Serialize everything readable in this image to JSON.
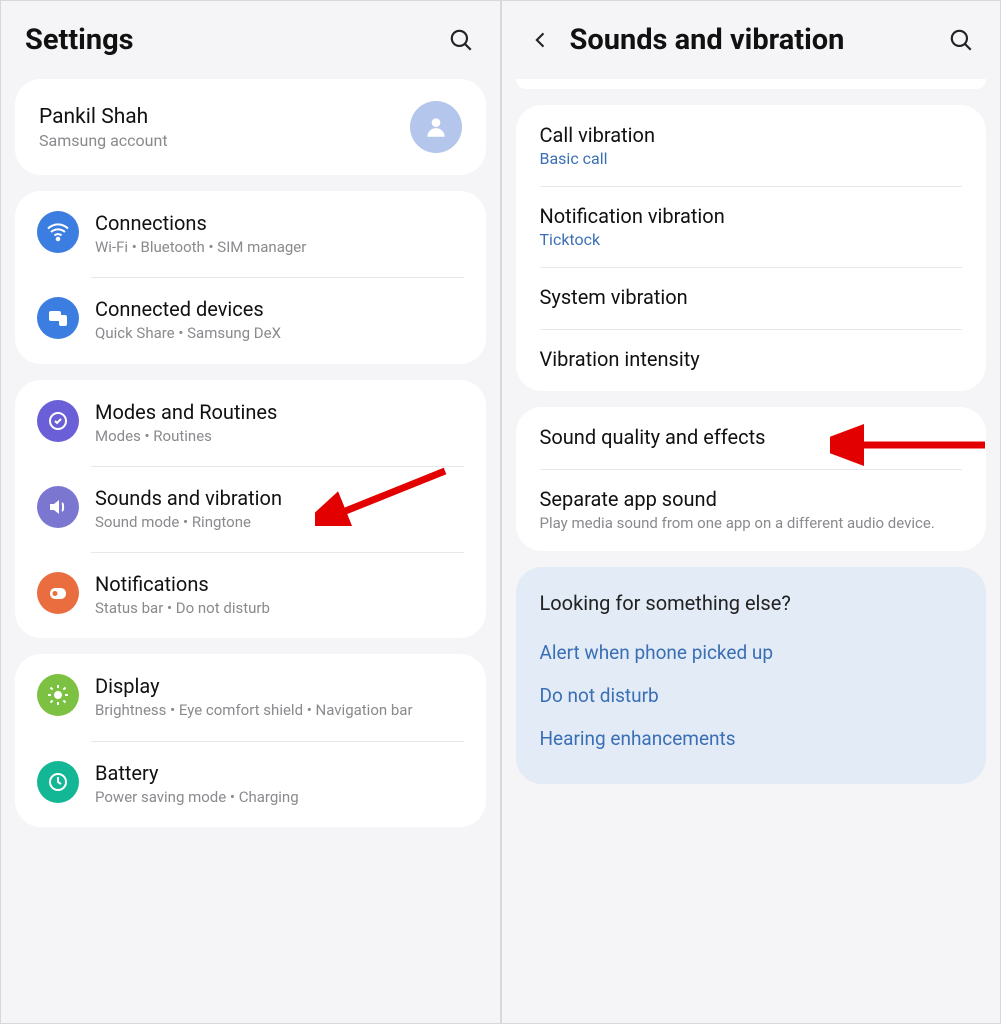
{
  "left": {
    "title": "Settings",
    "account": {
      "name": "Pankil Shah",
      "sub": "Samsung account"
    },
    "groups": [
      {
        "items": [
          {
            "icon": "wifi",
            "bg": "bg-wifi",
            "title": "Connections",
            "sub": "Wi-Fi  •  Bluetooth  •  SIM manager"
          },
          {
            "icon": "devices",
            "bg": "bg-devices",
            "title": "Connected devices",
            "sub": "Quick Share  •  Samsung DeX"
          }
        ]
      },
      {
        "items": [
          {
            "icon": "modes",
            "bg": "bg-modes",
            "title": "Modes and Routines",
            "sub": "Modes  •  Routines"
          },
          {
            "icon": "sound",
            "bg": "bg-sound",
            "title": "Sounds and vibration",
            "sub": "Sound mode  •  Ringtone"
          },
          {
            "icon": "notif",
            "bg": "bg-notif",
            "title": "Notifications",
            "sub": "Status bar  •  Do not disturb"
          }
        ]
      },
      {
        "items": [
          {
            "icon": "display",
            "bg": "bg-display",
            "title": "Display",
            "sub": "Brightness  •  Eye comfort shield  •  Navigation bar"
          },
          {
            "icon": "battery",
            "bg": "bg-battery",
            "title": "Battery",
            "sub": "Power saving mode  •  Charging"
          }
        ]
      }
    ]
  },
  "right": {
    "title": "Sounds and vibration",
    "groups": [
      {
        "items": [
          {
            "title": "Call vibration",
            "subBlue": "Basic call"
          },
          {
            "title": "Notification vibration",
            "subBlue": "Ticktock"
          },
          {
            "title": "System vibration"
          },
          {
            "title": "Vibration intensity"
          }
        ]
      },
      {
        "items": [
          {
            "title": "Sound quality and effects"
          },
          {
            "title": "Separate app sound",
            "subGray": "Play media sound from one app on a different audio device."
          }
        ]
      }
    ],
    "tip": {
      "title": "Looking for something else?",
      "links": [
        "Alert when phone picked up",
        "Do not disturb",
        "Hearing enhancements"
      ]
    }
  }
}
